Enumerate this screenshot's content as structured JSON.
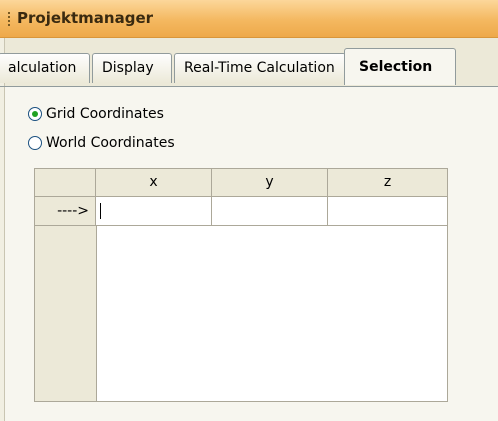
{
  "window": {
    "title": "Projektmanager"
  },
  "tabs": [
    {
      "label": "alculation"
    },
    {
      "label": "Display"
    },
    {
      "label": "Real-Time Calculation"
    },
    {
      "label": "Selection",
      "active": true
    }
  ],
  "tab_scroll": {
    "left": "◀",
    "right": "▷"
  },
  "options": {
    "grid_coordinates": {
      "label": "Grid Coordinates",
      "checked": true
    },
    "world_coordinates": {
      "label": "World Coordinates",
      "checked": false
    }
  },
  "table": {
    "columns": [
      "x",
      "y",
      "z"
    ],
    "rows": [
      {
        "marker": "---->",
        "x": "",
        "y": "",
        "z": ""
      }
    ]
  }
}
